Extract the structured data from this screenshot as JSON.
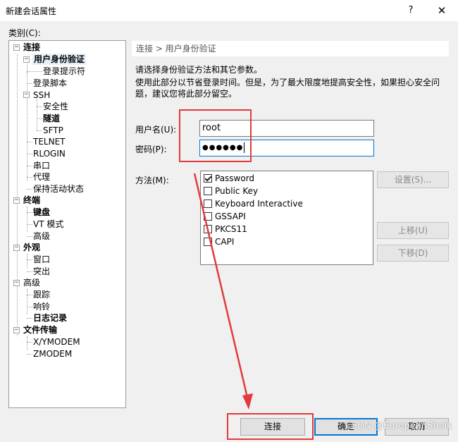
{
  "window": {
    "title": "新建会话属性",
    "help": "?",
    "close": "✕"
  },
  "category_label": "类别(C):",
  "tree": {
    "connection": "连接",
    "user_auth": "用户身份验证",
    "login_prompt": "登录提示符",
    "login_script": "登录脚本",
    "ssh": "SSH",
    "security": "安全性",
    "tunnel": "隧道",
    "sftp": "SFTP",
    "telnet": "TELNET",
    "rlogin": "RLOGIN",
    "serial": "串口",
    "proxy": "代理",
    "keepalive": "保持活动状态",
    "terminal": "终端",
    "keyboard": "键盘",
    "vt_mode": "VT 模式",
    "terminal_advanced": "高级",
    "appearance": "外观",
    "window": "窗口",
    "highlight": "突出",
    "advanced": "高级",
    "trace": "跟踪",
    "bell": "响铃",
    "logging": "日志记录",
    "file_transfer": "文件传输",
    "xymodem": "X/YMODEM",
    "zmodem": "ZMODEM"
  },
  "breadcrumb": "连接 > 用户身份验证",
  "description": {
    "line1": "请选择身份验证方法和其它参数。",
    "line2": "使用此部分以节省登录时间。但是，为了最大限度地提高安全性，如果担心安全问题，建议您将此部分留空。"
  },
  "form": {
    "username_label": "用户名(U):",
    "username_value": "root",
    "password_label": "密码(P):",
    "password_value": "●●●●●●",
    "method_label": "方法(M):"
  },
  "methods": [
    {
      "label": "Password",
      "checked": true
    },
    {
      "label": "Public Key",
      "checked": false
    },
    {
      "label": "Keyboard Interactive",
      "checked": false
    },
    {
      "label": "GSSAPI",
      "checked": false
    },
    {
      "label": "PKCS11",
      "checked": false
    },
    {
      "label": "CAPI",
      "checked": false
    }
  ],
  "buttons": {
    "settings": "设置(S)...",
    "move_up": "上移(U)",
    "move_down": "下移(D)",
    "connect": "连接",
    "ok": "确定",
    "cancel": "取消"
  },
  "watermark": "CSDN @EuropeanSheik",
  "colors": {
    "annotation_red": "#e23b3b",
    "focus_blue": "#0078d7",
    "selection_bg": "#e5f0fb"
  }
}
